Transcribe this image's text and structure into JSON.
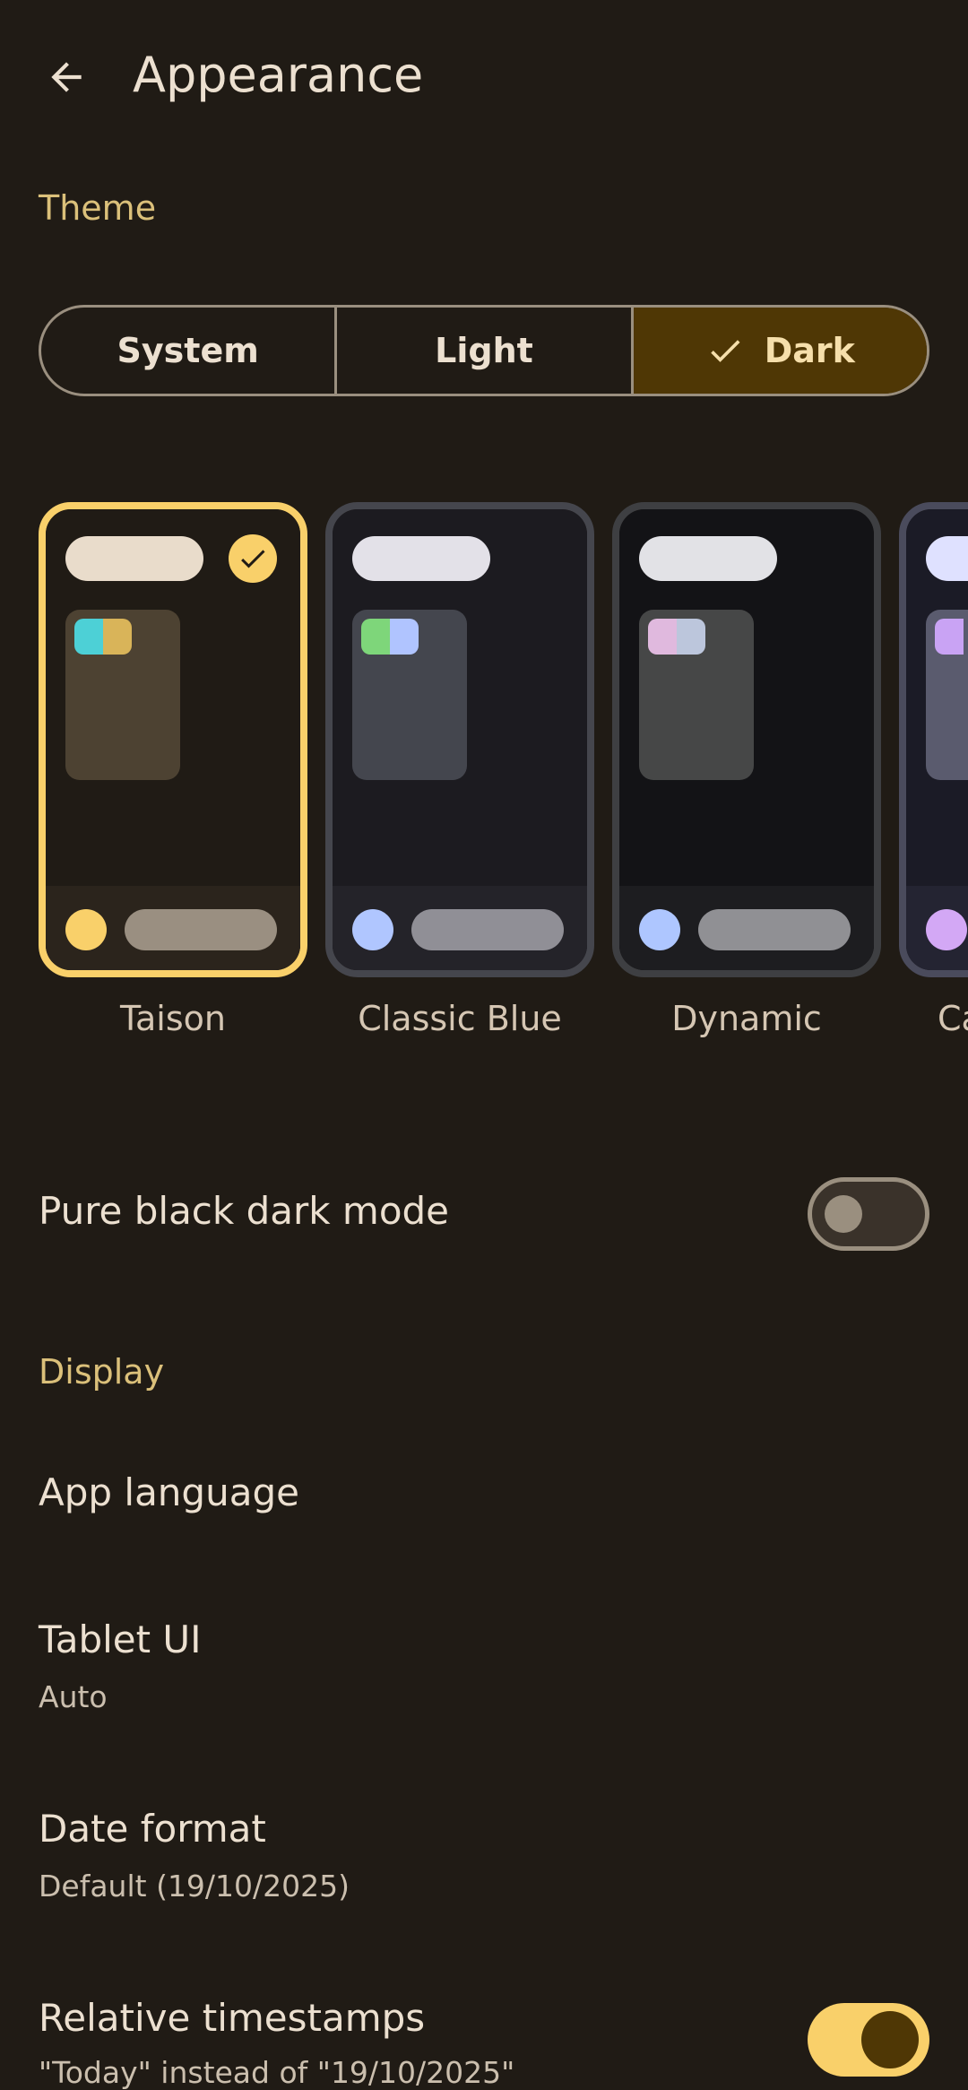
{
  "appbar": {
    "title": "Appearance"
  },
  "sections": {
    "theme": "Theme",
    "display": "Display"
  },
  "theme_mode": {
    "options": [
      "System",
      "Light",
      "Dark"
    ],
    "selected": "Dark"
  },
  "themes": [
    {
      "label": "Taison",
      "selected": true
    },
    {
      "label": "Classic Blue",
      "selected": false
    },
    {
      "label": "Dynamic",
      "selected": false
    },
    {
      "label": "Ca",
      "selected": false
    }
  ],
  "rows": {
    "pure_black": {
      "title": "Pure black dark mode",
      "enabled": false
    },
    "app_language": {
      "title": "App language"
    },
    "tablet_ui": {
      "title": "Tablet UI",
      "value": "Auto"
    },
    "date_format": {
      "title": "Date format",
      "value": "Default (19/10/2025)"
    },
    "relative_timestamps": {
      "title": "Relative timestamps",
      "subtitle": "\"Today\" instead of \"19/10/2025\"",
      "enabled": true
    }
  },
  "colors": {
    "background": "#201b15",
    "accent": "#f9d06a",
    "selected_segment": "#4f3705",
    "section_header": "#dbc07a"
  }
}
